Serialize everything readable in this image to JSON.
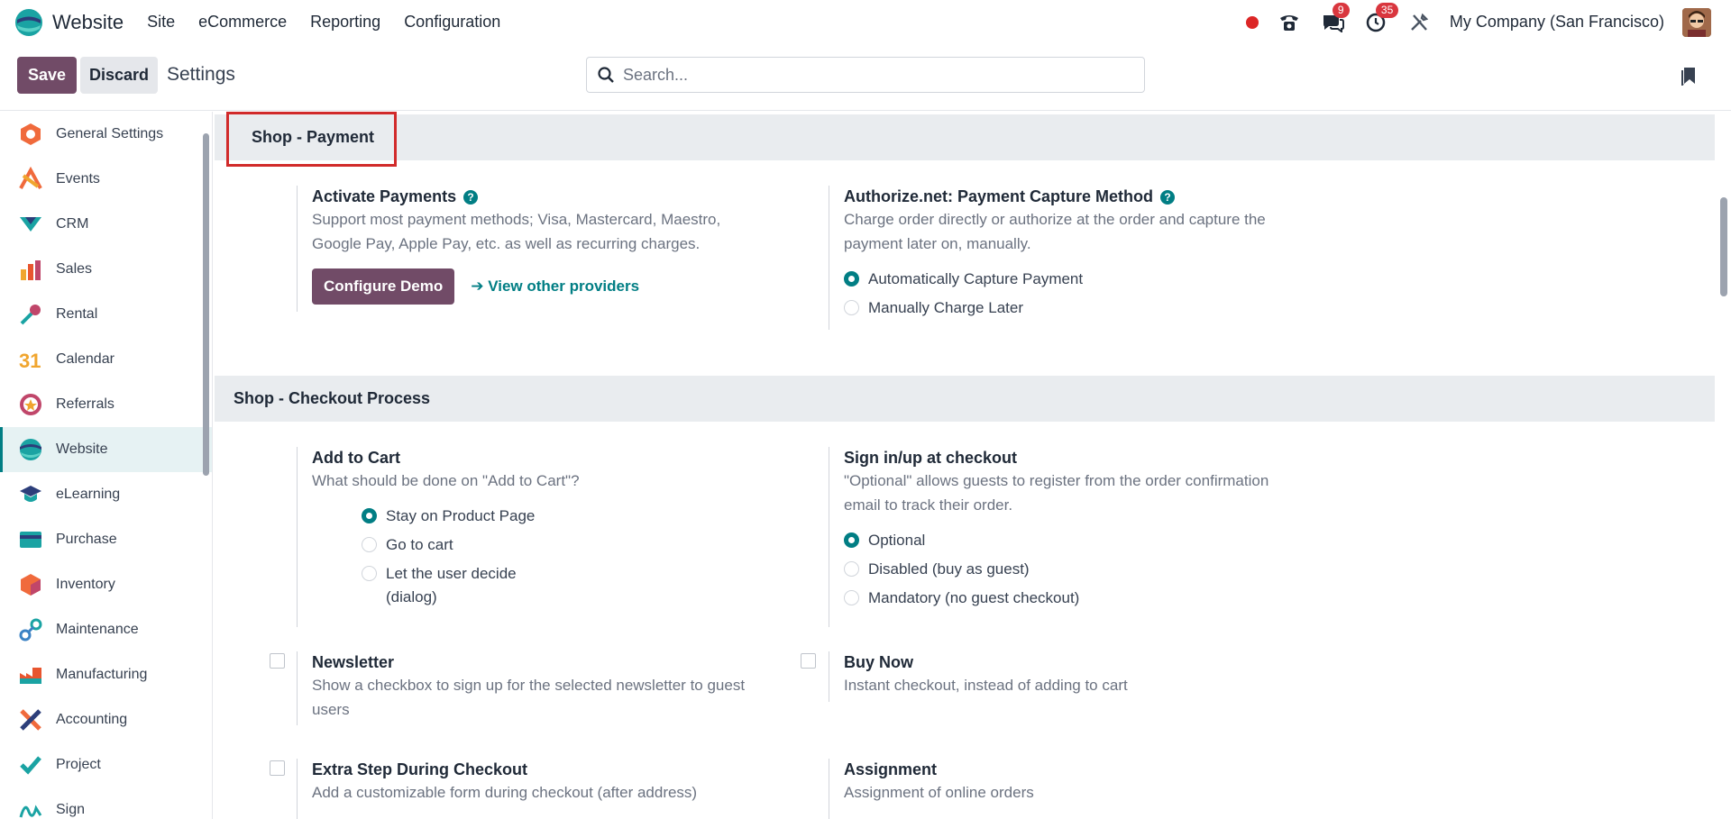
{
  "app": {
    "brand": "Website",
    "menu": [
      "Site",
      "eCommerce",
      "Reporting",
      "Configuration"
    ],
    "company": "My Company (San Francisco)",
    "messages_count": "9",
    "activities_count": "35"
  },
  "control": {
    "save_label": "Save",
    "discard_label": "Discard",
    "title": "Settings",
    "search_placeholder": "Search..."
  },
  "sidebar": {
    "items": [
      {
        "label": "General Settings",
        "icon": "general-settings-icon",
        "color": "#f06a3c"
      },
      {
        "label": "Events",
        "icon": "events-icon",
        "color": "#f06a3c"
      },
      {
        "label": "CRM",
        "icon": "crm-icon",
        "color": "#1aa3a3"
      },
      {
        "label": "Sales",
        "icon": "sales-icon",
        "color": "#e8552f"
      },
      {
        "label": "Rental",
        "icon": "rental-icon",
        "color": "#1aa3a3"
      },
      {
        "label": "Calendar",
        "icon": "calendar-icon",
        "color": "#f0a52e"
      },
      {
        "label": "Referrals",
        "icon": "referrals-icon",
        "color": "#c0466a"
      },
      {
        "label": "Website",
        "icon": "website-icon",
        "color": "#1aa3a3"
      },
      {
        "label": "eLearning",
        "icon": "elearning-icon",
        "color": "#1aa3a3"
      },
      {
        "label": "Purchase",
        "icon": "purchase-icon",
        "color": "#1aa3a3"
      },
      {
        "label": "Inventory",
        "icon": "inventory-icon",
        "color": "#f06a3c"
      },
      {
        "label": "Maintenance",
        "icon": "maintenance-icon",
        "color": "#3b82c4"
      },
      {
        "label": "Manufacturing",
        "icon": "manufacturing-icon",
        "color": "#e8552f"
      },
      {
        "label": "Accounting",
        "icon": "accounting-icon",
        "color": "#f06a3c"
      },
      {
        "label": "Project",
        "icon": "project-icon",
        "color": "#1aa3a3"
      },
      {
        "label": "Sign",
        "icon": "sign-icon",
        "color": "#1aa3a3"
      }
    ],
    "active": "Website"
  },
  "sections": {
    "payment": {
      "title": "Shop - Payment",
      "activate": {
        "title": "Activate Payments",
        "desc": "Support most payment methods; Visa, Mastercard, Maestro, Google Pay, Apple Pay, etc. as well as recurring charges.",
        "button": "Configure Demo",
        "link": "View other providers"
      },
      "capture": {
        "title": "Authorize.net: Payment Capture Method",
        "desc": "Charge order directly or authorize at the order and capture the payment later on, manually.",
        "options": [
          "Automatically Capture Payment",
          "Manually Charge Later"
        ],
        "selected": 0
      }
    },
    "checkout": {
      "title": "Shop - Checkout Process",
      "add_to_cart": {
        "title": "Add to Cart",
        "desc": "What should be done on \"Add to Cart\"?",
        "options": [
          "Stay on Product Page",
          "Go to cart",
          "Let the user decide (dialog)"
        ],
        "selected": 0
      },
      "signin": {
        "title": "Sign in/up at checkout",
        "desc": "\"Optional\" allows guests to register from the order confirmation email to track their order.",
        "options": [
          "Optional",
          "Disabled (buy as guest)",
          "Mandatory (no guest checkout)"
        ],
        "selected": 0
      },
      "newsletter": {
        "title": "Newsletter",
        "desc": "Show a checkbox to sign up for the selected newsletter to guest users",
        "checked": false
      },
      "buy_now": {
        "title": "Buy Now",
        "desc": "Instant checkout, instead of adding to cart",
        "checked": false
      },
      "extra_step": {
        "title": "Extra Step During Checkout",
        "desc": "Add a customizable form during checkout (after address)",
        "checked": false
      },
      "assignment": {
        "title": "Assignment",
        "desc": "Assignment of online orders"
      }
    }
  },
  "colors": {
    "primary": "#714b67",
    "accent": "#017e84",
    "highlight": "#d12a2a",
    "badge": "#d9363e"
  }
}
